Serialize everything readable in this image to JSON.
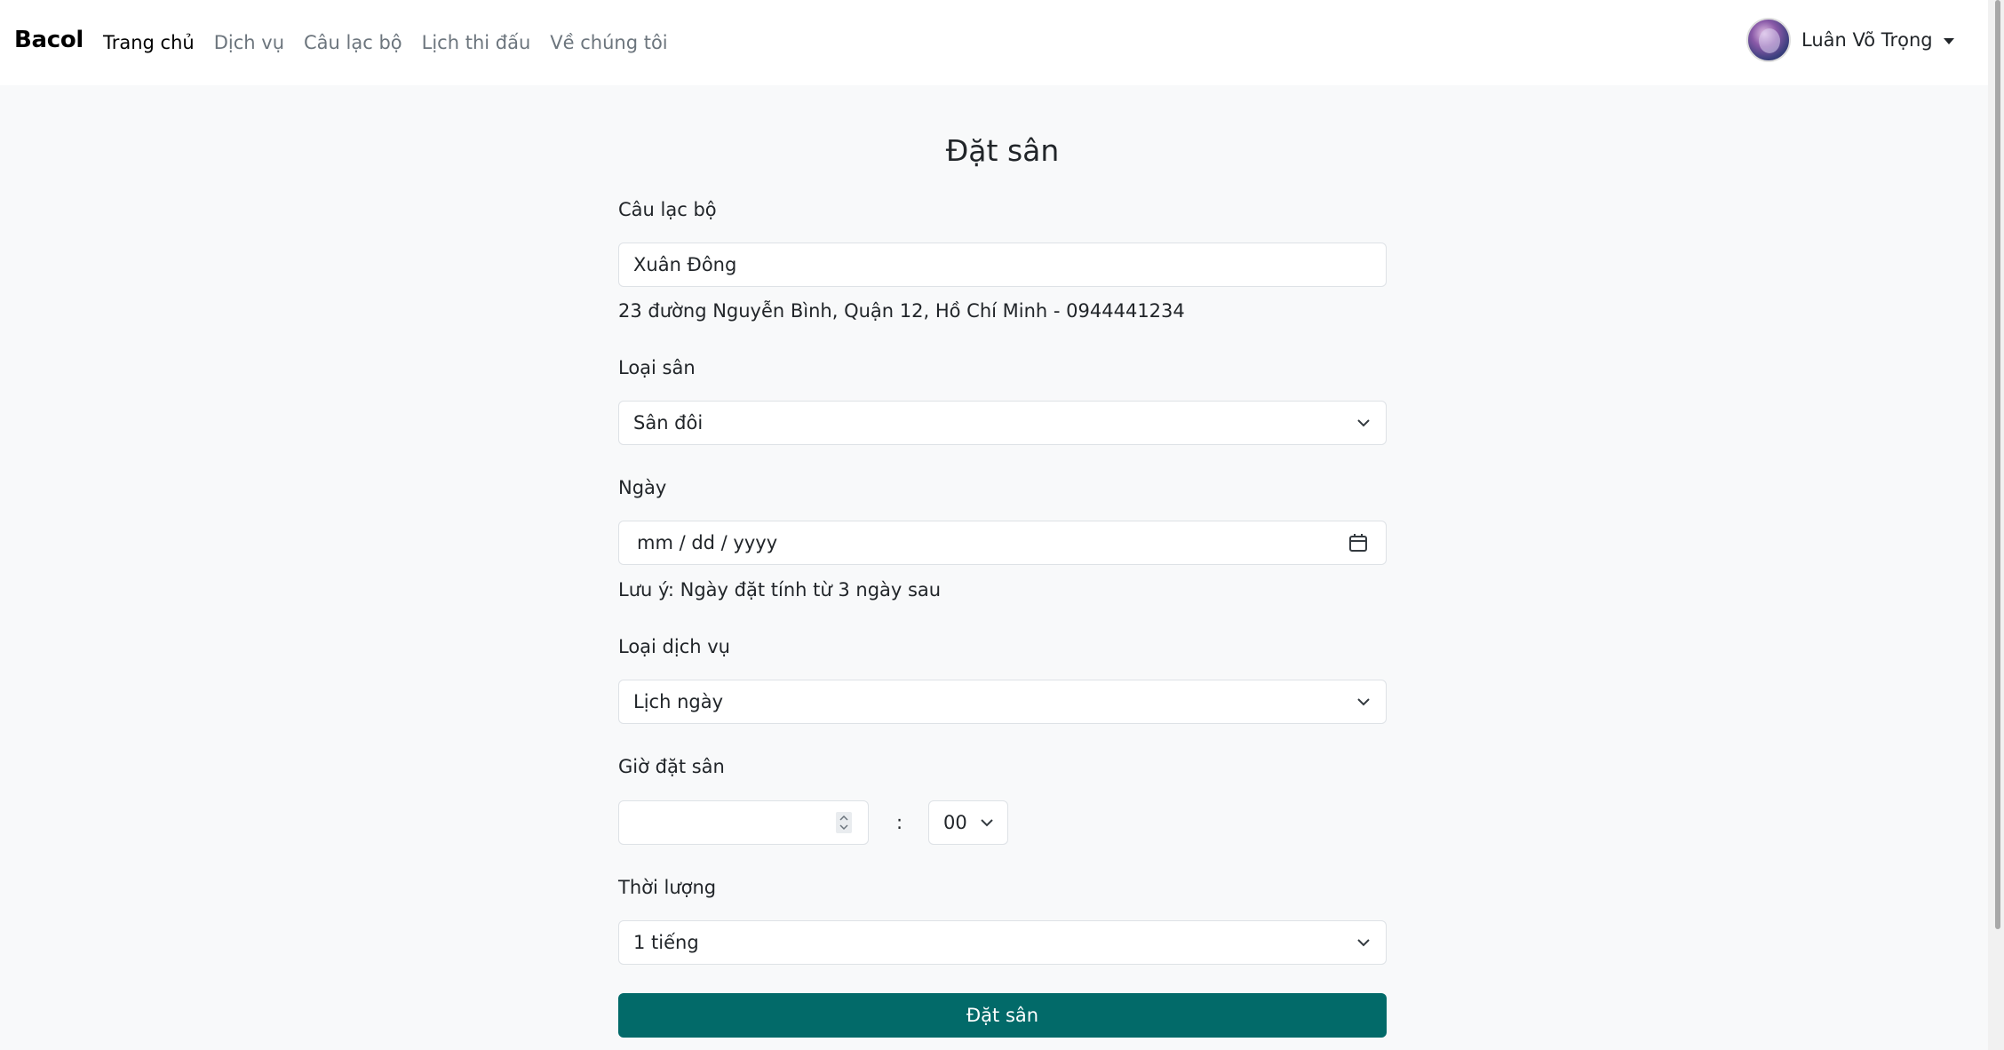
{
  "navbar": {
    "brand": "Bacol",
    "links": [
      {
        "label": "Trang chủ",
        "active": true
      },
      {
        "label": "Dịch vụ"
      },
      {
        "label": "Câu lạc bộ"
      },
      {
        "label": "Lịch thi đấu"
      },
      {
        "label": "Về chúng tôi"
      }
    ],
    "user_name": "Luân Võ Trọng"
  },
  "form": {
    "title": "Đặt sân",
    "club_label": "Câu lạc bộ",
    "club_value": "Xuân Đông",
    "club_address": "23 đường Nguyễn Bình, Quận 12, Hồ Chí Minh - 0944441234",
    "court_type_label": "Loại sân",
    "court_type_value": "Sân đôi",
    "date_label": "Ngày",
    "date_placeholder": "mm / dd / yyyy",
    "date_note": "Lưu ý: Ngày đặt tính từ 3 ngày sau",
    "service_label": "Loại dịch vụ",
    "service_value": "Lịch ngày",
    "time_label": "Giờ đặt sân",
    "time_separator": ":",
    "minute_value": "00",
    "duration_label": "Thời lượng",
    "duration_value": "1 tiếng",
    "submit_label": "Đặt sân"
  },
  "colors": {
    "primary": "#026a69",
    "background": "#f8f9fa",
    "navbar_bg": "#ffffff"
  }
}
